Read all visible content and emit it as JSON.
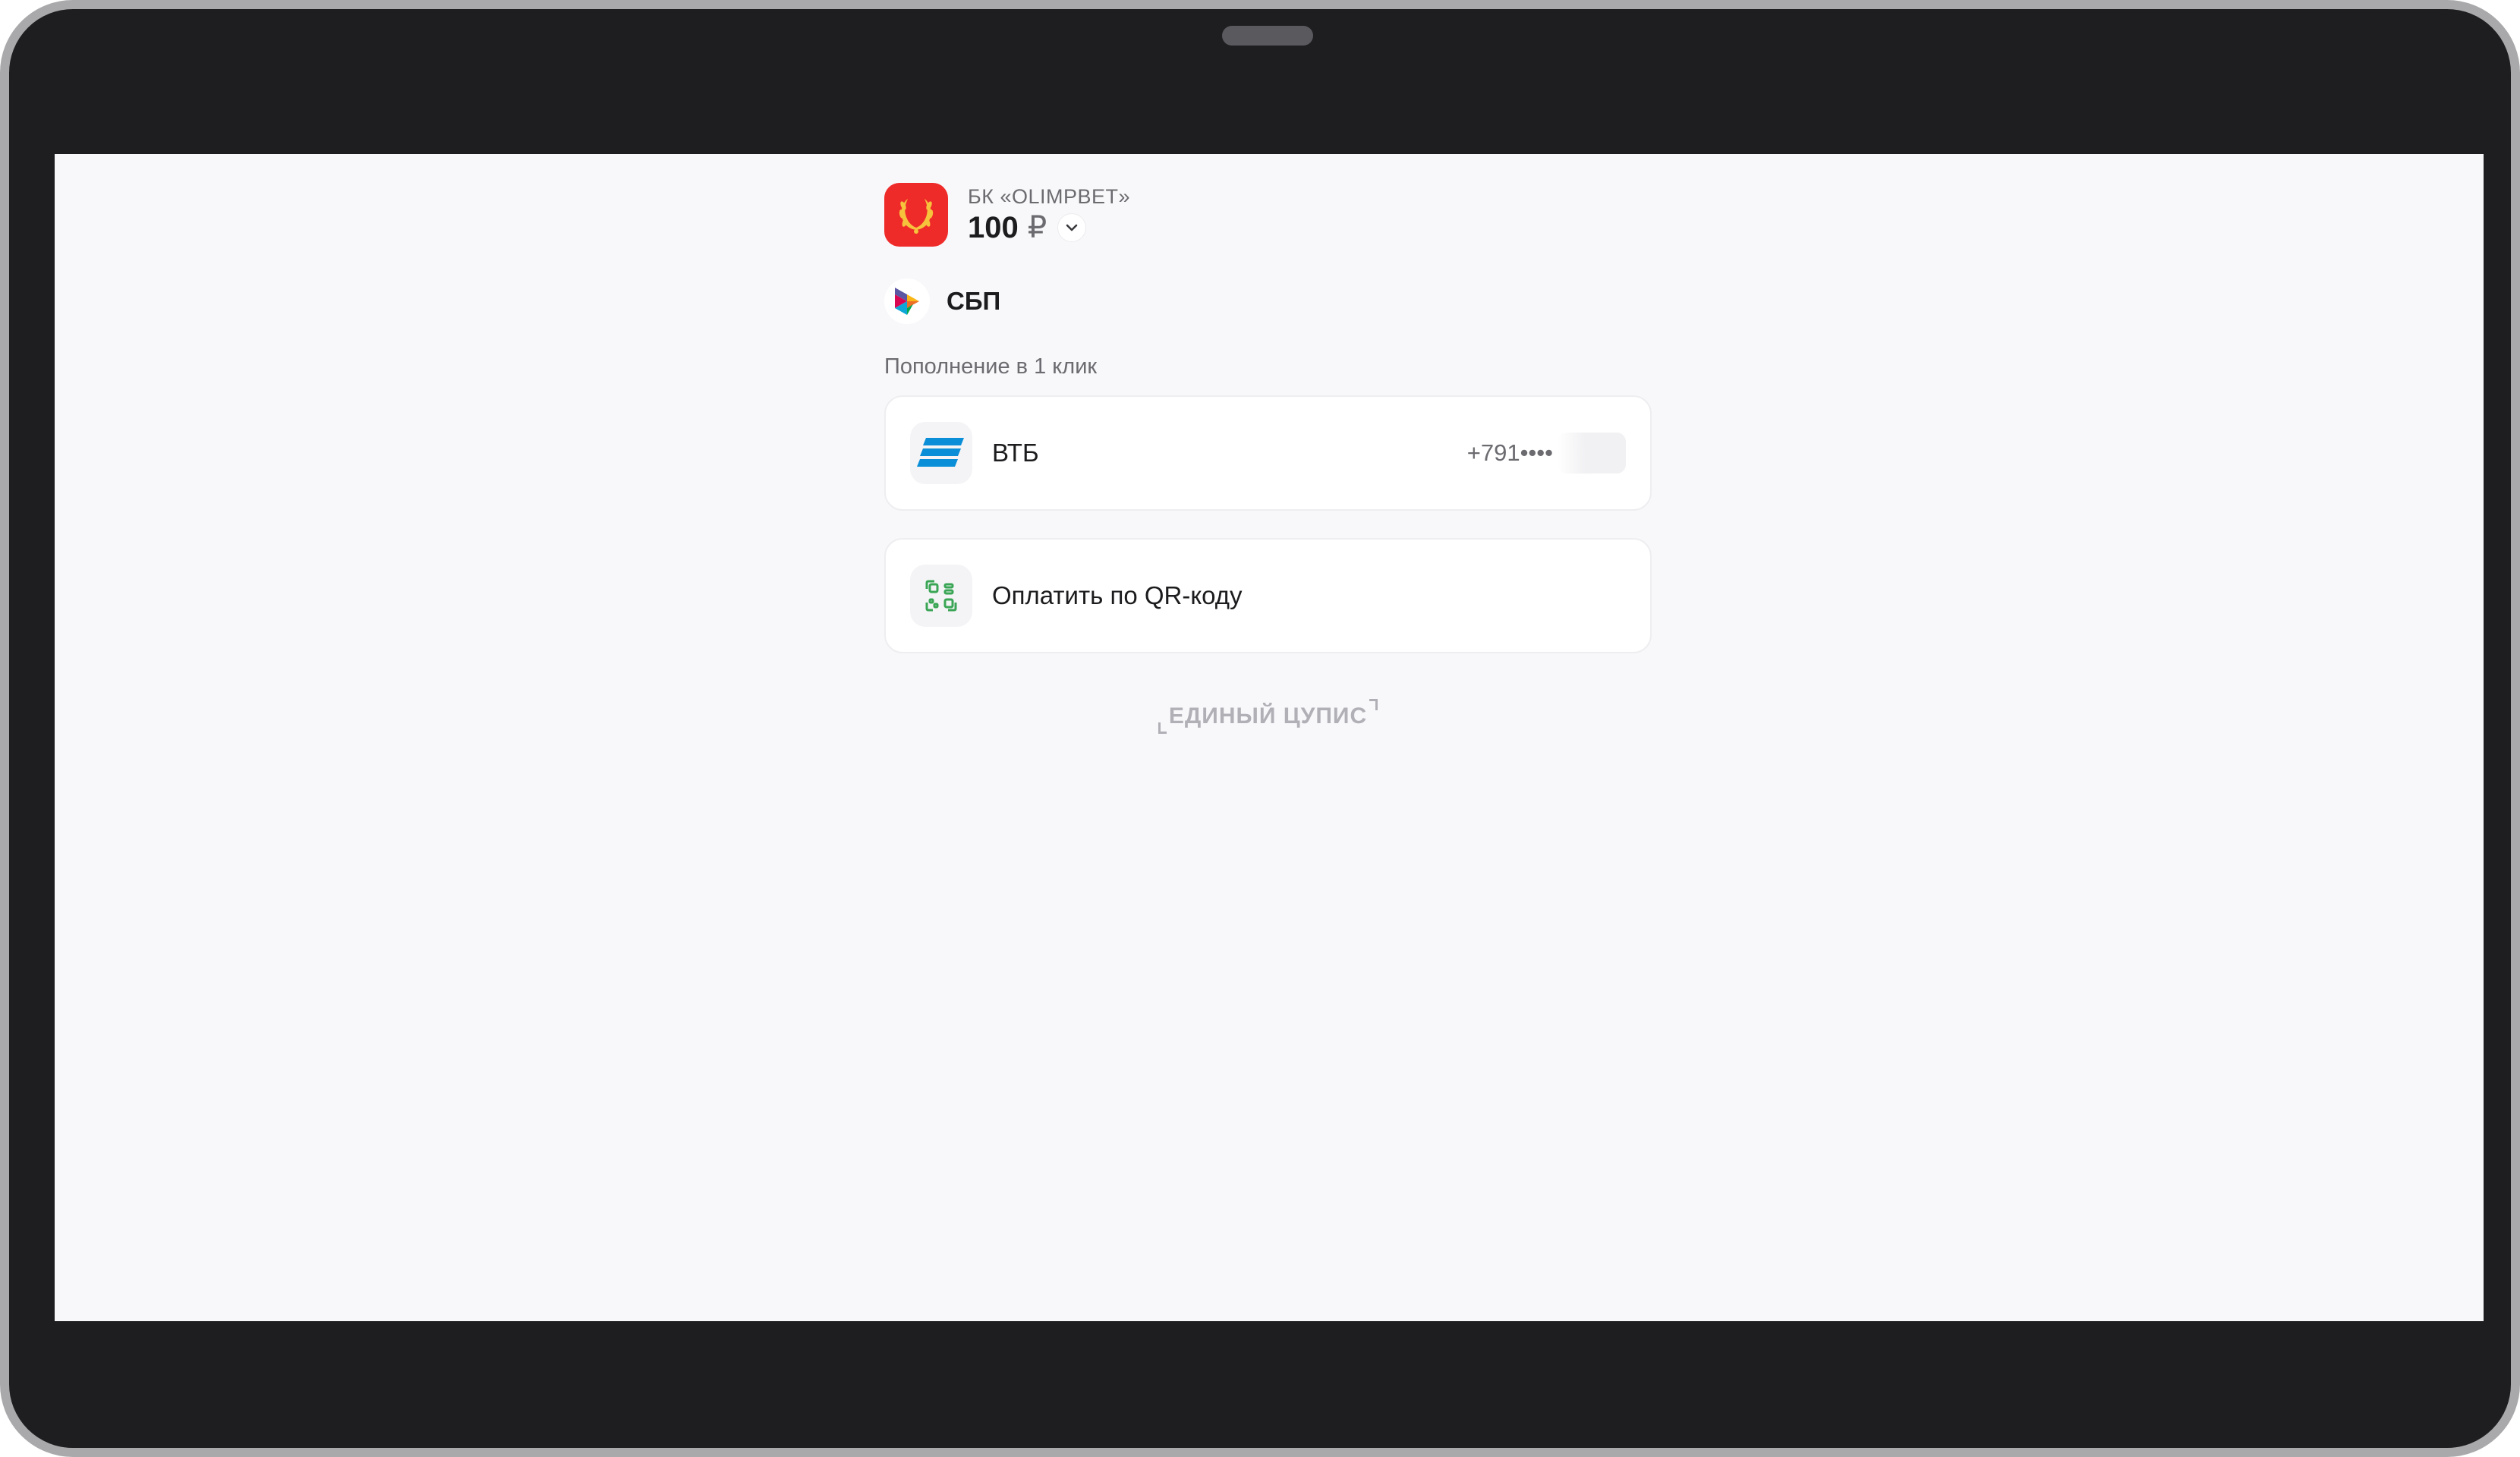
{
  "merchant": {
    "name": "БК «OLIMPBET»",
    "amount": "100",
    "currency": "₽",
    "logo_icon": "laurel-wreath-icon",
    "logo_color": "#ef2b2a"
  },
  "payment_method": {
    "label": "СБП",
    "icon": "sbp-logo-icon"
  },
  "one_click": {
    "title": "Пополнение в 1 клик"
  },
  "banks": [
    {
      "name": "ВТБ",
      "phone": "+791••••",
      "icon": "vtb-logo-icon",
      "color": "#0a8ed8"
    }
  ],
  "qr_option": {
    "label": "Оплатить по QR-коду",
    "icon": "qr-code-icon",
    "color": "#3aa655"
  },
  "footer": {
    "brand": "ЕДИНЫЙ ЦУПИС"
  }
}
